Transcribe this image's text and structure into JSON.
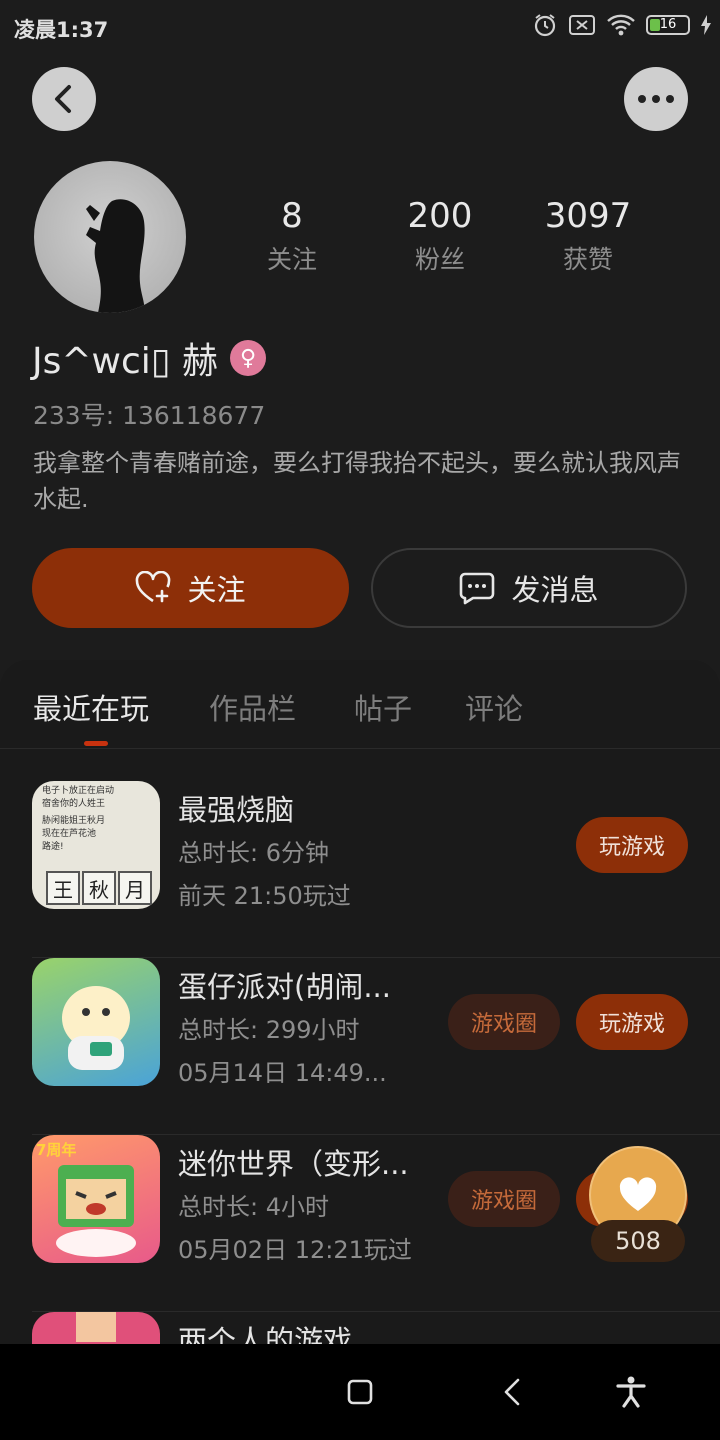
{
  "status_bar": {
    "time": "凌晨1:37",
    "battery": "16"
  },
  "profile": {
    "username": "Js^wci▯ 赫",
    "gender_symbol": "♀",
    "uid": "233号: 136118677",
    "bio": "我拿整个青春赌前途，要么打得我抬不起头，要么就认我风声水起.",
    "stats": [
      {
        "value": "8",
        "label": "关注"
      },
      {
        "value": "200",
        "label": "粉丝"
      },
      {
        "value": "3097",
        "label": "获赞"
      }
    ]
  },
  "actions": {
    "follow_label": "关注",
    "message_label": "发消息"
  },
  "tabs": [
    {
      "label": "最近在玩",
      "active": true
    },
    {
      "label": "作品栏",
      "active": false
    },
    {
      "label": "帖子",
      "active": false
    },
    {
      "label": "评论",
      "active": false
    }
  ],
  "games": [
    {
      "title": "最强烧脑",
      "duration": "总时长: 6分钟",
      "last_played": "前天 21:50玩过",
      "play_label": "玩游戏",
      "circle_label": ""
    },
    {
      "title": "蛋仔派对(胡闹...",
      "duration": "总时长: 299小时",
      "last_played": "05月14日 14:49...",
      "play_label": "玩游戏",
      "circle_label": "游戏圈"
    },
    {
      "title": "迷你世界（变形...",
      "duration": "总时长: 4小时",
      "last_played": "05月02日 12:21玩过",
      "play_label": "",
      "circle_label": "游戏圈"
    },
    {
      "title": "两个人的游戏",
      "duration": "",
      "last_played": "",
      "play_label": "",
      "circle_label": ""
    }
  ],
  "game1_icon": {
    "line1": "电子卜放正在启动",
    "line2": "宿舍你的人姓王",
    "line3": "胁闲能姐王秋月",
    "line4": "现在在芦花池",
    "line5": "路途!",
    "chars": [
      "王",
      "秋",
      "月"
    ]
  },
  "game3_badge": "7周年",
  "like_float": {
    "count": "508"
  },
  "colors": {
    "accent": "#8d2f08",
    "background": "#1c1c1c",
    "like": "#e7a84e"
  }
}
